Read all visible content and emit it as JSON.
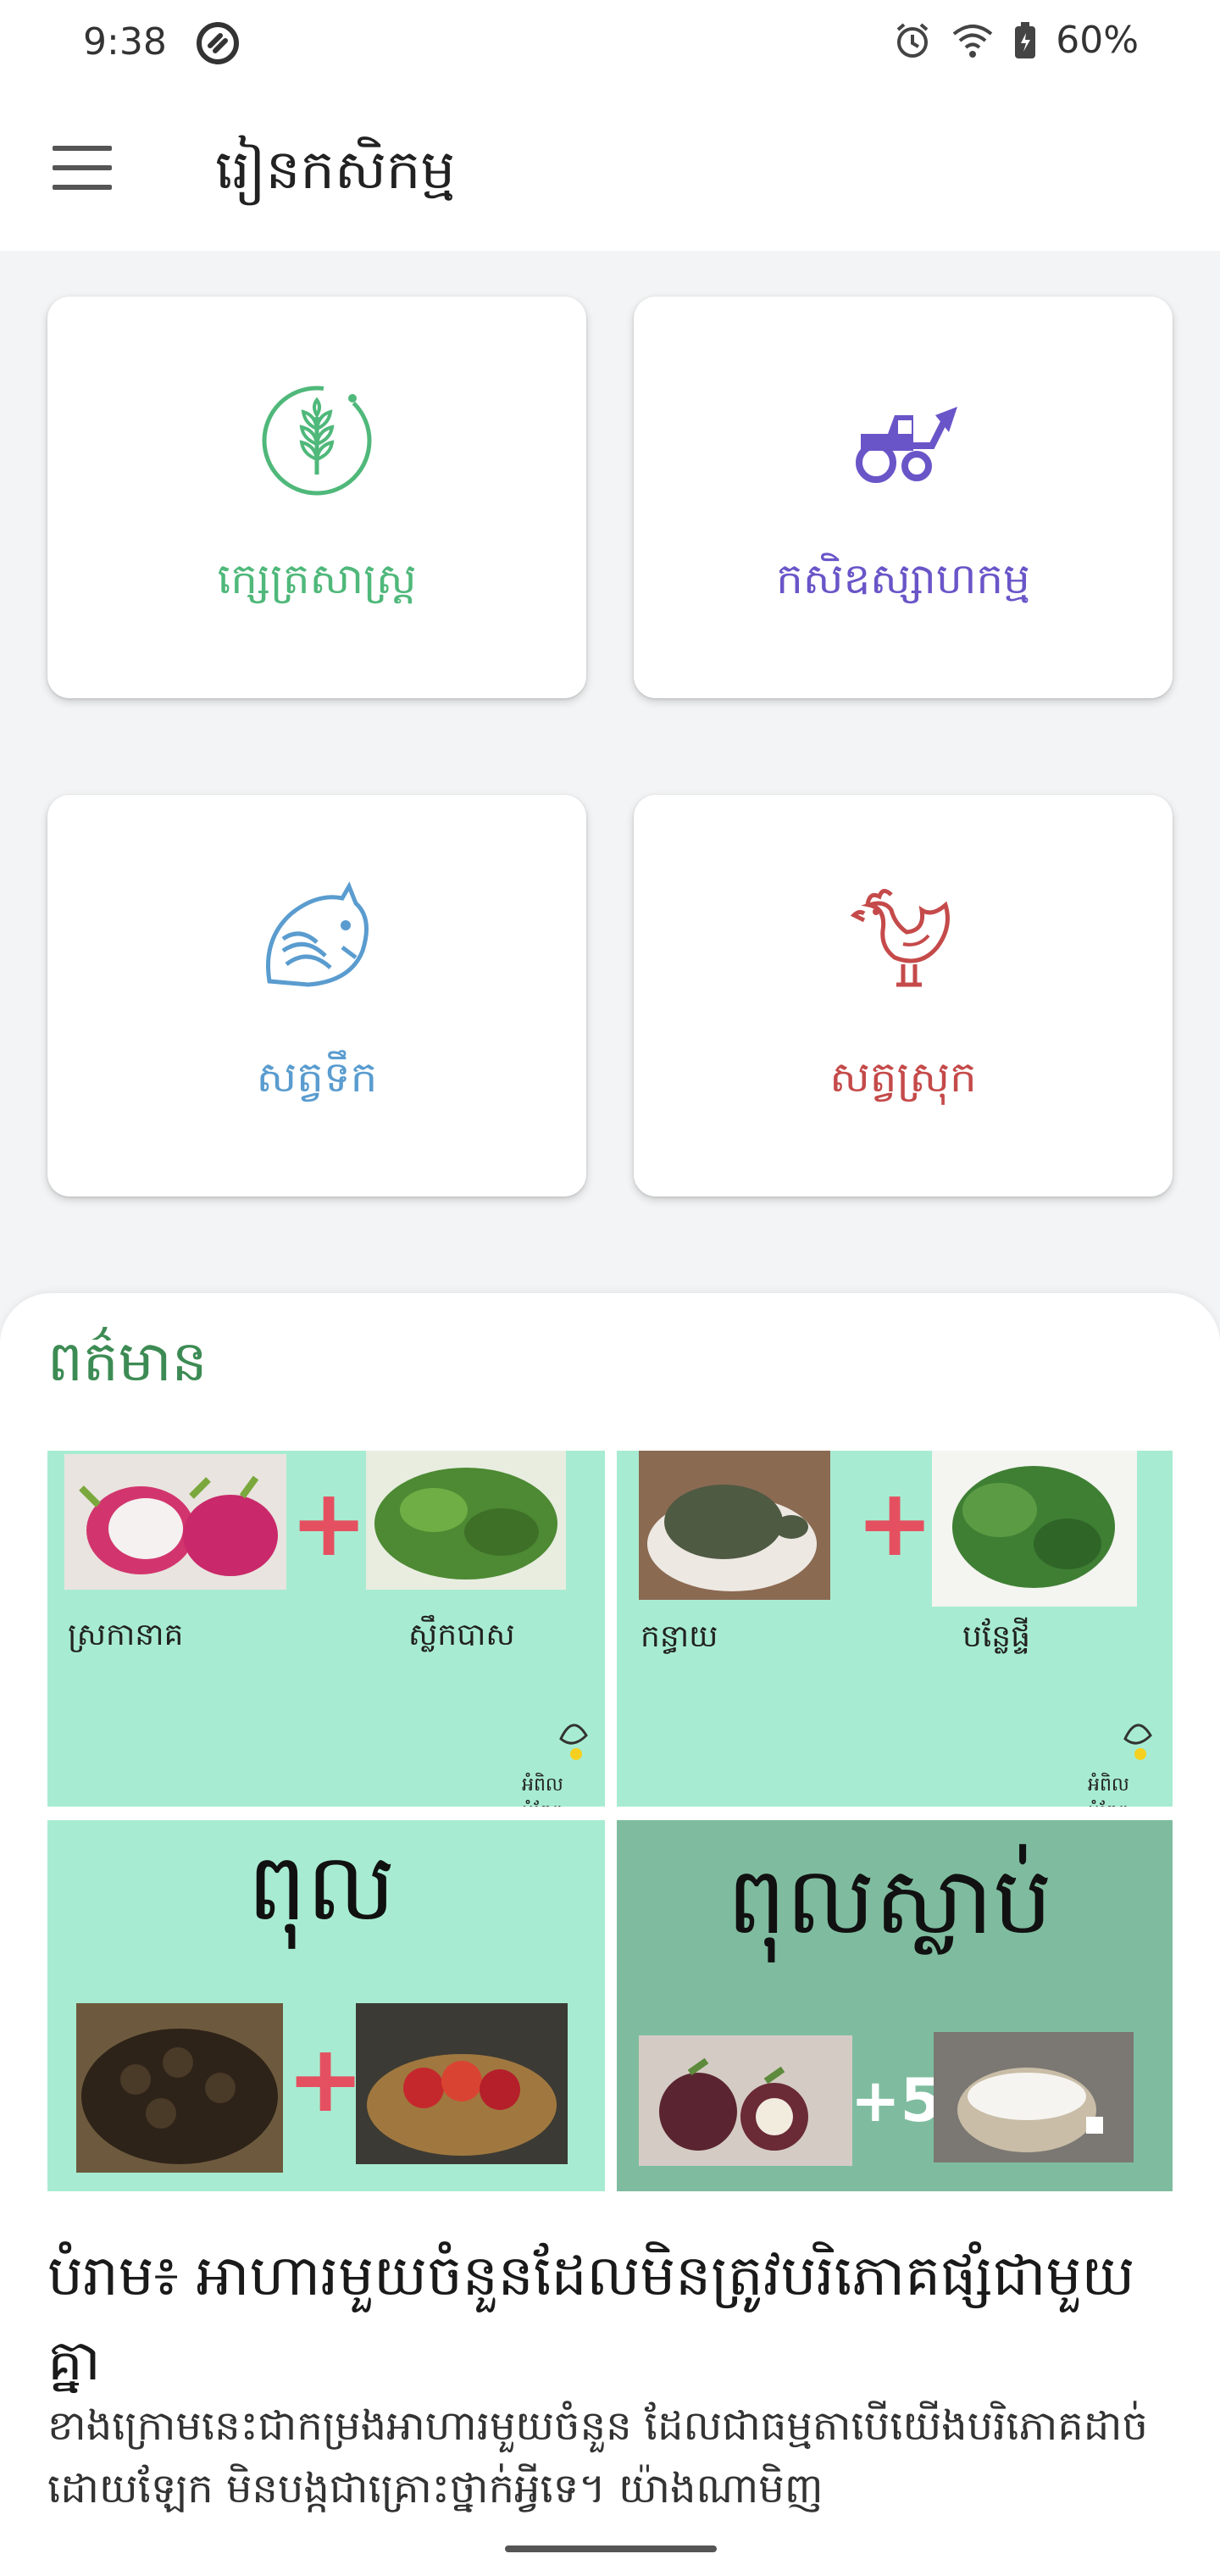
{
  "status_bar": {
    "time": "9:38",
    "battery": "60%"
  },
  "app_bar": {
    "title": "រៀនកសិកម្ម"
  },
  "categories": [
    {
      "label": "ក្សេត្រសាស្ត្រ",
      "icon": "wheat-icon",
      "color": "#4fb87a"
    },
    {
      "label": "កសិឧស្សាហកម្ម",
      "icon": "tractor-icon",
      "color": "#6a55c8"
    },
    {
      "label": "សត្វទឹក",
      "icon": "fish-icon",
      "color": "#5a9ccf"
    },
    {
      "label": "សត្វស្រុក",
      "icon": "rooster-icon",
      "color": "#c54a4a"
    }
  ],
  "news": {
    "heading": "ពត៌មាន",
    "collage": {
      "tile1": {
        "left": "ស្រកានាគ",
        "right": "ស្លឹកបាស",
        "logo": "អំពិល អំពែក"
      },
      "tile2": {
        "left": "កន្ធាយ",
        "right": "បន្លែផ្ទី",
        "logo": "អំពិល អំពែក"
      },
      "tile3": {
        "title": "ពុល"
      },
      "tile4": {
        "title": "ពុលស្លាប់",
        "badge": "+5"
      }
    },
    "article": {
      "title": "បំរាម៖ អាហារមួយចំនួនដែលមិនត្រូវបរិភោគផ្សំជាមួយគ្នា",
      "excerpt": "ខាងក្រោមនេះជាកម្រងអាហារមួយចំនួន ដែលជាធម្មតាបើយើងបរិភោគដាច់ដោយឡែក មិនបង្កជាគ្រោះថ្នាក់អ្វីទេ។ យ៉ាងណាមិញ"
    }
  },
  "colors": {
    "accent_green": "#3d8b54",
    "collage_mint": "#a7ecd2"
  }
}
